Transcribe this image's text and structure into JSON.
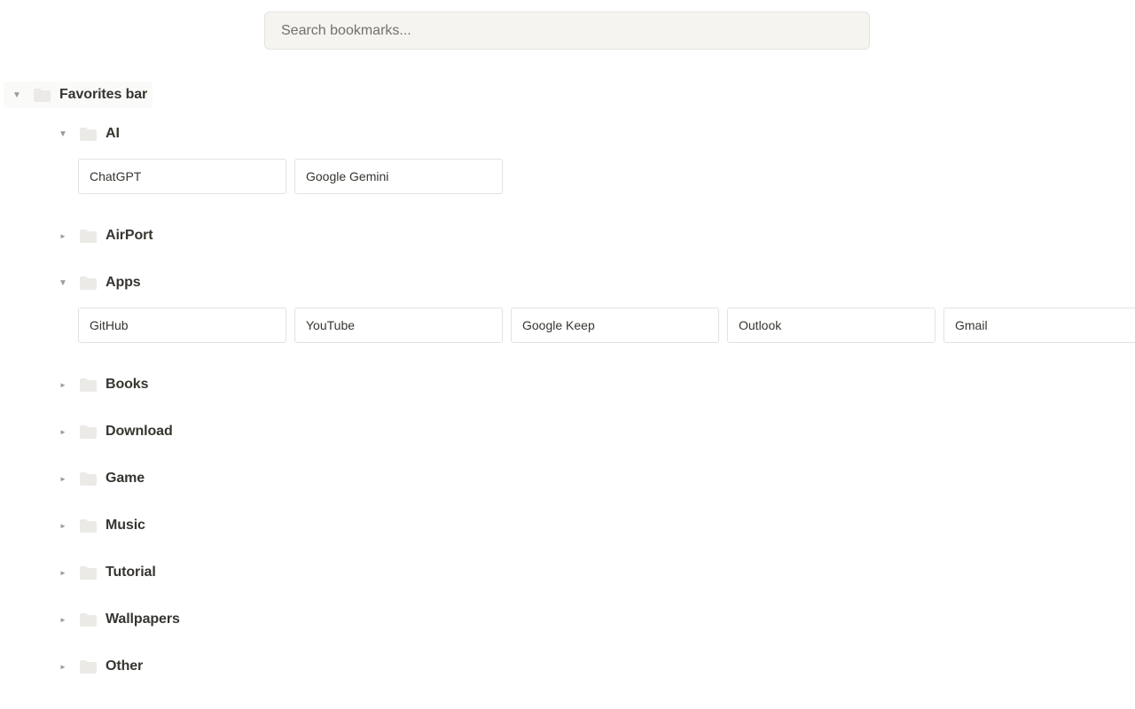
{
  "search": {
    "placeholder": "Search bookmarks..."
  },
  "root": {
    "label": "Favorites bar",
    "expanded": true,
    "icon": "folder-icon",
    "toggle": "▼"
  },
  "folders": [
    {
      "label": "AI",
      "expanded": true,
      "toggle": "▼",
      "bookmarks": [
        "ChatGPT",
        "Google Gemini"
      ]
    },
    {
      "label": "AirPort",
      "expanded": false,
      "toggle": "►",
      "bookmarks": []
    },
    {
      "label": "Apps",
      "expanded": true,
      "toggle": "▼",
      "bookmarks": [
        "GitHub",
        "YouTube",
        "Google Keep",
        "Outlook",
        "Gmail"
      ]
    },
    {
      "label": "Books",
      "expanded": false,
      "toggle": "►",
      "bookmarks": []
    },
    {
      "label": "Download",
      "expanded": false,
      "toggle": "►",
      "bookmarks": []
    },
    {
      "label": "Game",
      "expanded": false,
      "toggle": "►",
      "bookmarks": []
    },
    {
      "label": "Music",
      "expanded": false,
      "toggle": "►",
      "bookmarks": []
    },
    {
      "label": "Tutorial",
      "expanded": false,
      "toggle": "►",
      "bookmarks": []
    },
    {
      "label": "Wallpapers",
      "expanded": false,
      "toggle": "►",
      "bookmarks": []
    },
    {
      "label": "Other",
      "expanded": false,
      "toggle": "►",
      "bookmarks": []
    }
  ],
  "colors": {
    "folder_icon": "#ebeae7",
    "toggle": "#9b9a97",
    "text": "#37352f",
    "search_bg": "#f5f4f1"
  }
}
